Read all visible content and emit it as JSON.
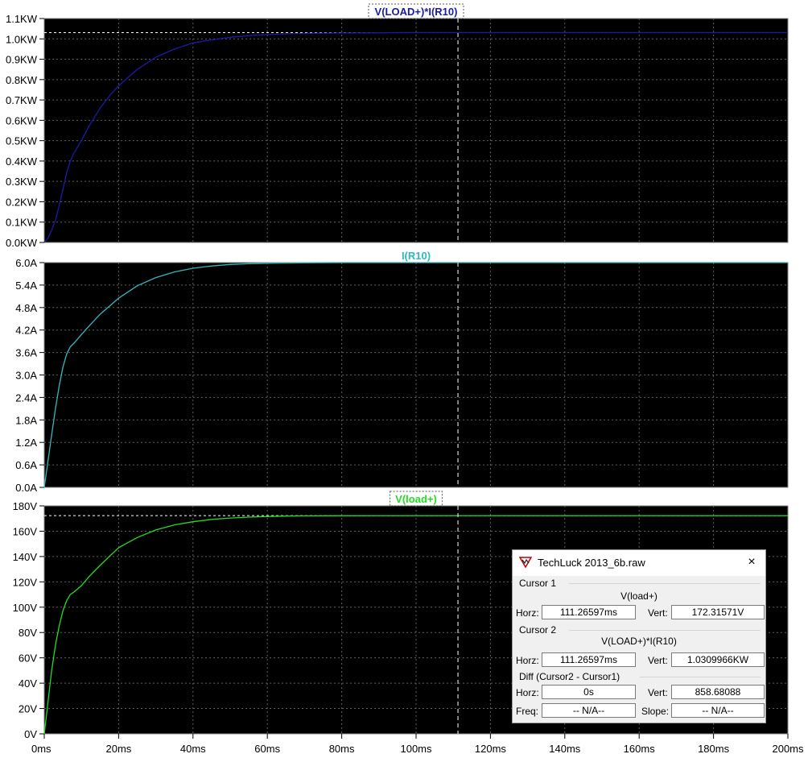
{
  "colors": {
    "background": "#000000",
    "grid": "#606060",
    "cursor": "#ffffff",
    "axis_text": "#000000"
  },
  "x_axis": {
    "range": [
      0,
      200
    ],
    "tick_labels": [
      "0ms",
      "20ms",
      "40ms",
      "60ms",
      "80ms",
      "100ms",
      "120ms",
      "140ms",
      "160ms",
      "180ms",
      "200ms"
    ]
  },
  "cursor_x": 111.26597,
  "chart_data": [
    {
      "type": "line",
      "title": "V(LOAD+)*I(R10)",
      "title_boxed": true,
      "color": "#1a1aa8",
      "title_color": "#1a1aa8",
      "xlim": [
        0,
        200
      ],
      "ylim": [
        0,
        1.1
      ],
      "y_tick_labels": [
        "1.1KW",
        "1.0KW",
        "0.9KW",
        "0.8KW",
        "0.7KW",
        "0.6KW",
        "0.5KW",
        "0.4KW",
        "0.3KW",
        "0.2KW",
        "0.1KW",
        "0.0KW"
      ],
      "series": [
        {
          "x": [
            0,
            1,
            2,
            3,
            4,
            5,
            6,
            7,
            8,
            10,
            12,
            15,
            18,
            20,
            25,
            30,
            35,
            40,
            45,
            50,
            55,
            60,
            65,
            70,
            80,
            90,
            100,
            110,
            120,
            140,
            160,
            180,
            200
          ],
          "values": [
            0,
            0.02,
            0.06,
            0.11,
            0.18,
            0.26,
            0.34,
            0.4,
            0.44,
            0.5,
            0.57,
            0.66,
            0.73,
            0.77,
            0.85,
            0.91,
            0.95,
            0.98,
            0.995,
            1.008,
            1.016,
            1.021,
            1.025,
            1.027,
            1.029,
            1.03,
            1.031,
            1.031,
            1.031,
            1.031,
            1.031,
            1.031,
            1.031
          ]
        }
      ],
      "cursor_y": 1.0309966
    },
    {
      "type": "line",
      "title": "I(R10)",
      "title_boxed": false,
      "color": "#30b8c0",
      "title_color": "#30b8c0",
      "xlim": [
        0,
        200
      ],
      "ylim": [
        0,
        6
      ],
      "y_tick_labels": [
        "6.0A",
        "5.4A",
        "4.8A",
        "4.2A",
        "3.6A",
        "3.0A",
        "2.4A",
        "1.8A",
        "1.2A",
        "0.6A",
        "0.0A"
      ],
      "series": [
        {
          "x": [
            0,
            1,
            2,
            3,
            4,
            5,
            6,
            7,
            8,
            10,
            12,
            15,
            20,
            25,
            30,
            35,
            40,
            45,
            50,
            55,
            60,
            65,
            70,
            80,
            90,
            100,
            120,
            140,
            160,
            180,
            200
          ],
          "values": [
            0,
            0.7,
            1.4,
            2.1,
            2.7,
            3.2,
            3.55,
            3.75,
            3.85,
            4.08,
            4.3,
            4.62,
            5.05,
            5.38,
            5.6,
            5.75,
            5.85,
            5.91,
            5.95,
            5.97,
            5.98,
            5.99,
            5.995,
            6.0,
            6.0,
            6.0,
            6.0,
            6.0,
            6.0,
            6.0,
            6.0
          ]
        }
      ]
    },
    {
      "type": "line",
      "title": "V(load+)",
      "title_boxed": true,
      "color": "#22dd22",
      "title_color": "#22dd22",
      "xlim": [
        0,
        200
      ],
      "ylim": [
        0,
        180
      ],
      "y_tick_labels": [
        "180V",
        "160V",
        "140V",
        "120V",
        "100V",
        "80V",
        "60V",
        "40V",
        "20V",
        "0V"
      ],
      "series": [
        {
          "x": [
            0,
            1,
            2,
            3,
            4,
            5,
            6,
            7,
            8,
            10,
            12,
            15,
            20,
            25,
            30,
            35,
            40,
            45,
            50,
            55,
            60,
            65,
            70,
            80,
            90,
            100,
            120,
            140,
            160,
            180,
            200
          ],
          "values": [
            0,
            25,
            50,
            70,
            85,
            97,
            105,
            110,
            112,
            117,
            124,
            133,
            147,
            155,
            161,
            165,
            167.5,
            169.3,
            170.4,
            171.1,
            171.6,
            171.9,
            172.1,
            172.25,
            172.3,
            172.3,
            172.3,
            172.3,
            172.3,
            172.3,
            172.3
          ]
        }
      ],
      "cursor_y": 172.31571
    }
  ],
  "dialog": {
    "title": "TechLuck 2013_6b.raw",
    "close_icon": "×",
    "cursor1": {
      "label": "Cursor 1",
      "expr": "V(load+)",
      "horz_label": "Horz:",
      "horz": "111.26597ms",
      "vert_label": "Vert:",
      "vert": "172.31571V"
    },
    "cursor2": {
      "label": "Cursor 2",
      "expr": "V(LOAD+)*I(R10)",
      "horz_label": "Horz:",
      "horz": "111.26597ms",
      "vert_label": "Vert:",
      "vert": "1.0309966KW"
    },
    "diff": {
      "label": "Diff (Cursor2 - Cursor1)",
      "horz_label": "Horz:",
      "horz": "0s",
      "vert_label": "Vert:",
      "vert": "858.68088",
      "freq_label": "Freq:",
      "freq": "-- N/A--",
      "slope_label": "Slope:",
      "slope": "-- N/A--"
    }
  }
}
